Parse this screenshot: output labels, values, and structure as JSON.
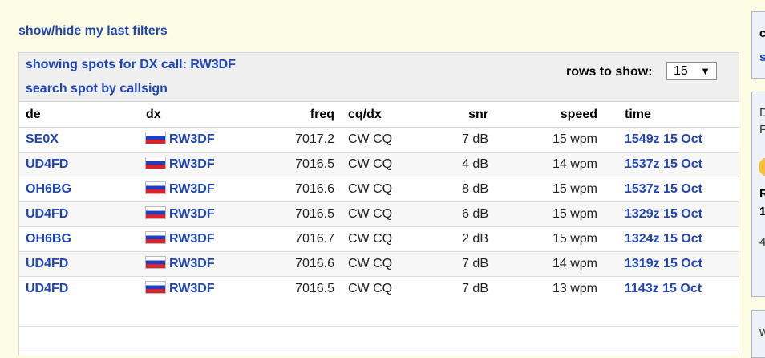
{
  "filters_toggle": "show/hide my last filters",
  "header": {
    "showing_spots": "showing spots for DX call: RW3DF",
    "search_link": "search spot by callsign",
    "rows_label": "rows to show:",
    "rows_value": "15"
  },
  "columns": {
    "de": "de",
    "dx": "dx",
    "freq": "freq",
    "cqdx": "cq/dx",
    "snr": "snr",
    "speed": "speed",
    "time": "time"
  },
  "spots": [
    {
      "de": "SE0X",
      "dx": "RW3DF",
      "freq": "7017.2",
      "cqdx": "CW CQ",
      "snr": "7 dB",
      "speed": "15 wpm",
      "time": "1549z 15 Oct"
    },
    {
      "de": "UD4FD",
      "dx": "RW3DF",
      "freq": "7016.5",
      "cqdx": "CW CQ",
      "snr": "4 dB",
      "speed": "14 wpm",
      "time": "1537z 15 Oct"
    },
    {
      "de": "OH6BG",
      "dx": "RW3DF",
      "freq": "7016.6",
      "cqdx": "CW CQ",
      "snr": "8 dB",
      "speed": "15 wpm",
      "time": "1537z 15 Oct"
    },
    {
      "de": "UD4FD",
      "dx": "RW3DF",
      "freq": "7016.5",
      "cqdx": "CW CQ",
      "snr": "6 dB",
      "speed": "15 wpm",
      "time": "1329z 15 Oct"
    },
    {
      "de": "OH6BG",
      "dx": "RW3DF",
      "freq": "7016.7",
      "cqdx": "CW CQ",
      "snr": "2 dB",
      "speed": "15 wpm",
      "time": "1324z 15 Oct"
    },
    {
      "de": "UD4FD",
      "dx": "RW3DF",
      "freq": "7016.6",
      "cqdx": "CW CQ",
      "snr": "7 dB",
      "speed": "14 wpm",
      "time": "1319z 15 Oct"
    },
    {
      "de": "UD4FD",
      "dx": "RW3DF",
      "freq": "7016.5",
      "cqdx": "CW CQ",
      "snr": "7 dB",
      "speed": "13 wpm",
      "time": "1143z 15 Oct"
    }
  ],
  "side_panel": {
    "box1": [
      "c",
      "s"
    ],
    "box2": [
      "D",
      "F",
      "R",
      "1",
      "4"
    ],
    "box3": [
      "w"
    ]
  },
  "colors": {
    "link": "#1f46b4",
    "page_bg": "#fdfde6",
    "header_bg": "#efefef",
    "flag": [
      "#ffffff",
      "#1c3fc4",
      "#d8232a"
    ]
  },
  "icons": {
    "flag": "russia-flag-icon",
    "dropdown": "chevron-down-icon"
  }
}
